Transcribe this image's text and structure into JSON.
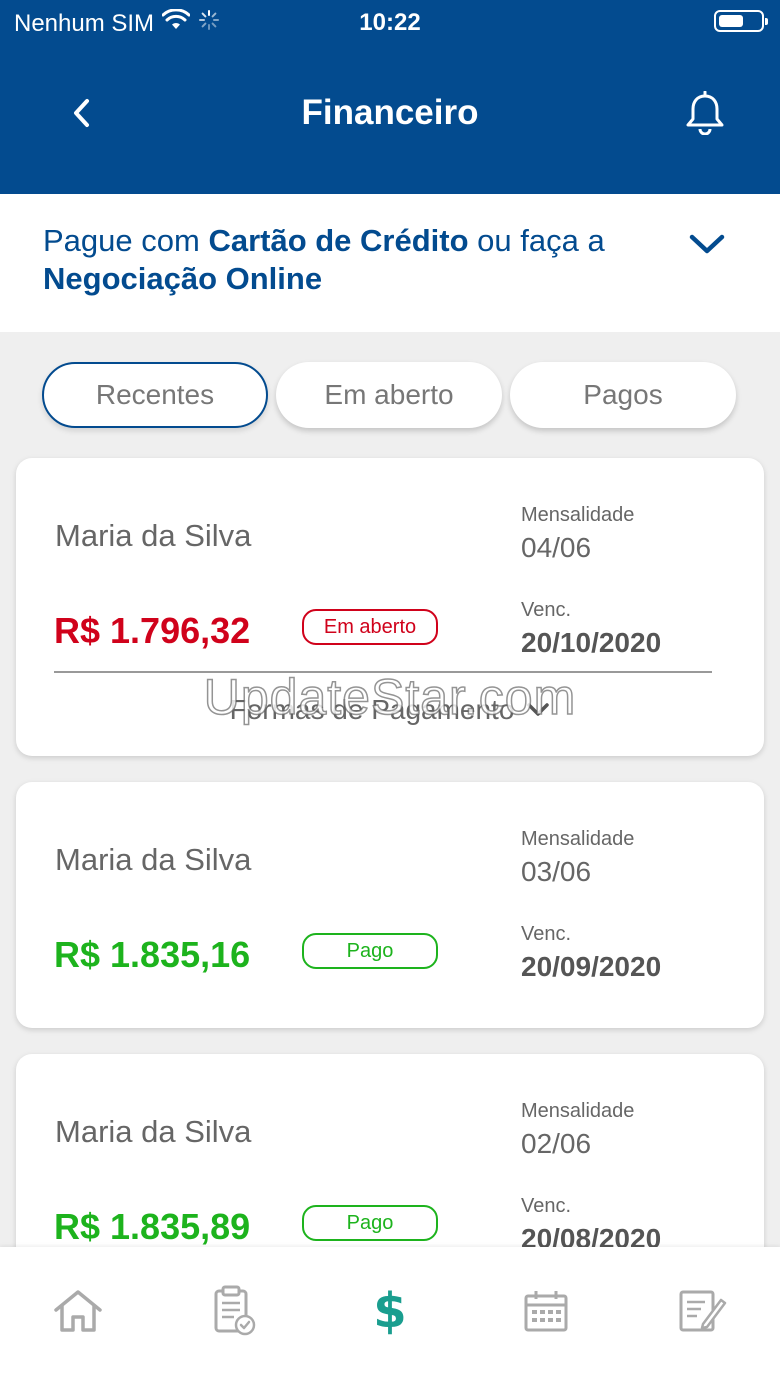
{
  "status_bar": {
    "carrier": "Nenhum SIM",
    "time": "10:22",
    "battery_level": 0.6
  },
  "header": {
    "title": "Financeiro"
  },
  "promo": {
    "prefix": "Pague com ",
    "card": "Cartão de Crédito",
    "middle": " ou faça a ",
    "negotiation": "Negociação Online"
  },
  "tabs": [
    {
      "label": "Recentes",
      "active": true
    },
    {
      "label": "Em aberto",
      "active": false
    },
    {
      "label": "Pagos",
      "active": false
    }
  ],
  "cards": [
    {
      "name": "Maria da Silva",
      "amount": "R$ 1.796,32",
      "status": "Em aberto",
      "status_color": "#d0021b",
      "type_label": "Mensalidade",
      "installment": "04/06",
      "due_label": "Venc.",
      "due_date": "20/10/2020",
      "payment_methods_label": "Formas de Pagamento"
    },
    {
      "name": "Maria da Silva",
      "amount": "R$ 1.835,16",
      "status": "Pago",
      "status_color": "#1db31d",
      "type_label": "Mensalidade",
      "installment": "03/06",
      "due_label": "Venc.",
      "due_date": "20/09/2020"
    },
    {
      "name": "Maria da Silva",
      "amount": "R$ 1.835,89",
      "status": "Pago",
      "status_color": "#1db31d",
      "type_label": "Mensalidade",
      "installment": "02/06",
      "due_label": "Venc.",
      "due_date": "20/08/2020"
    }
  ],
  "watermark": "UpdateStar.com",
  "bottom_nav": [
    {
      "icon": "home-icon",
      "active": false
    },
    {
      "icon": "clipboard-check-icon",
      "active": false
    },
    {
      "icon": "dollar-icon",
      "active": true
    },
    {
      "icon": "calendar-icon",
      "active": false
    },
    {
      "icon": "edit-document-icon",
      "active": false
    }
  ],
  "colors": {
    "primary": "#034b8f",
    "open": "#d0021b",
    "paid": "#1db31d",
    "active_nav": "#1a9e8f"
  }
}
